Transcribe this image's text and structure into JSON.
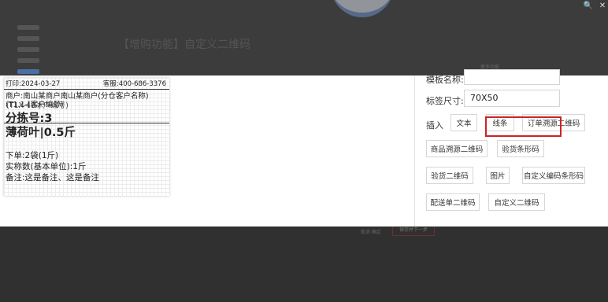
{
  "background": {
    "page_title": "【增购功能】自定义二维码",
    "mini_text": "更多功能",
    "bottom_btn1": "取消 确定",
    "bottom_btn2": "保存并下一步"
  },
  "window": {
    "search_glyph": "🔍",
    "close_glyph": "✕"
  },
  "label_preview": {
    "print_date": "打印:2024-03-27",
    "service": "客服:400-686-3376",
    "merchant": "商户:南山某商户南山某商户(分仓客户名称)",
    "code_a": "(T1.1-[客户编号)",
    "code_b": "(T1X-48冰户编号)",
    "sort_no": "分拣号:3",
    "product": "薄荷叶|0.5斤",
    "order_qty": "下单:2袋(1斤)",
    "actual_qty": "实称数(基本单位):1斤",
    "remark": "备注:这是备注、这是备注"
  },
  "form": {
    "template_name_label": "模板名称:",
    "template_name_value": "",
    "size_label": "标签尺寸:",
    "size_value": "70X50",
    "insert_label": "插入",
    "buttons": {
      "text": "文本",
      "line": "线条",
      "order_trace_qr": "订单溯源二维码",
      "product_trace_qr": "商品溯源二维码",
      "inspect_barcode": "验货条形码",
      "inspect_qr": "验货二维码",
      "image": "图片",
      "custom_barcode": "自定义编码条形码",
      "delivery_qr": "配送单二维码",
      "custom_qr": "自定义二维码"
    }
  },
  "colors": {
    "highlight": "#cc2424",
    "overlay": "#3a3a3a"
  }
}
